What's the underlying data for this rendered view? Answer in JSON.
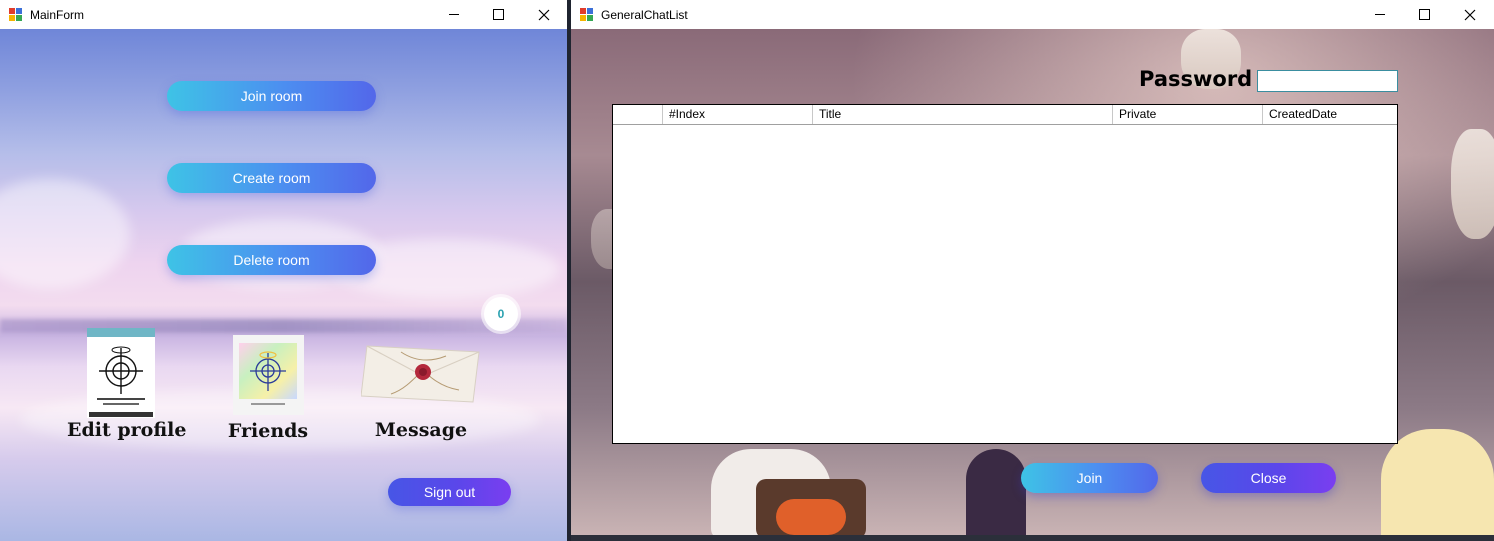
{
  "main_window": {
    "title": "MainForm",
    "buttons": {
      "join_room": "Join room",
      "create_room": "Create room",
      "delete_room": "Delete room",
      "sign_out": "Sign out"
    },
    "notification_count": "0",
    "tiles": {
      "edit_profile": "Edit profile",
      "friends": "Friends",
      "message": "Message"
    },
    "colors": {
      "button_gradient_start": "#3ec3e6",
      "button_gradient_end": "#5367ea",
      "signout_gradient_end": "#7a3ef0"
    }
  },
  "chat_window": {
    "title": "GeneralChatList",
    "password_label": "Password",
    "password_value": "",
    "grid": {
      "columns": [
        "",
        "#Index",
        "Title",
        "Private",
        "CreatedDate"
      ],
      "rows": []
    },
    "buttons": {
      "join": "Join",
      "close": "Close"
    }
  }
}
